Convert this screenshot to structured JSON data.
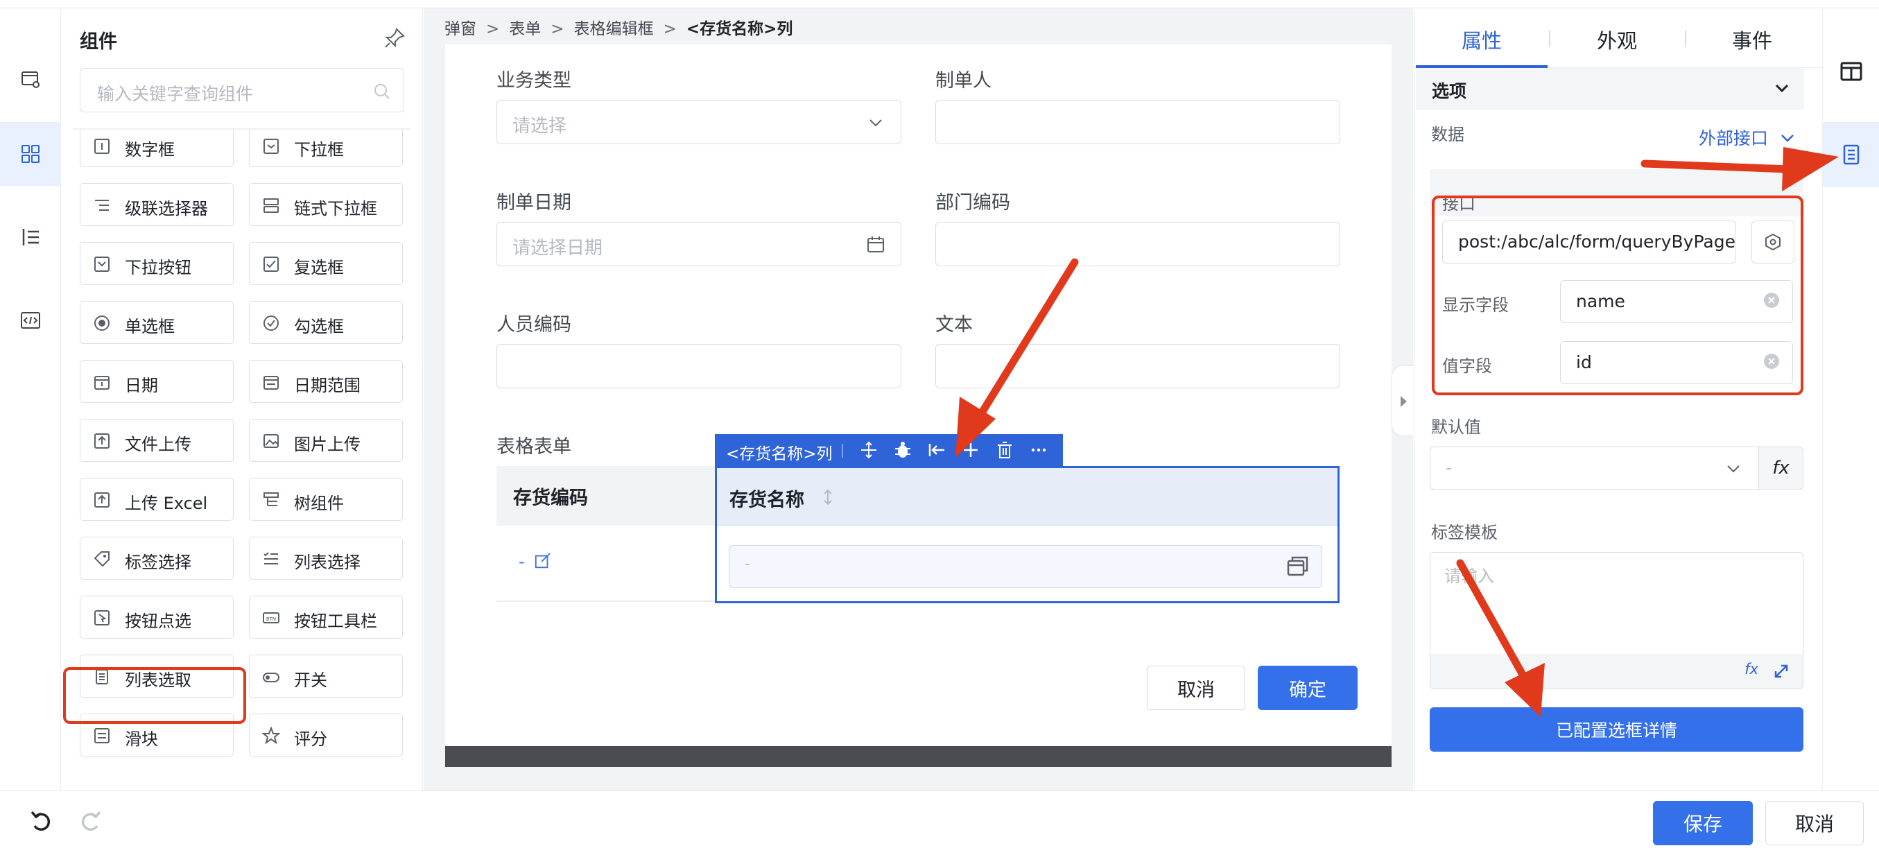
{
  "components_panel": {
    "title": "组件",
    "search_placeholder": "输入关键字查询组件",
    "items": [
      {
        "label": "数字框",
        "icon": "number-icon"
      },
      {
        "label": "下拉框",
        "icon": "dropdown-icon"
      },
      {
        "label": "级联选择器",
        "icon": "cascade-icon"
      },
      {
        "label": "链式下拉框",
        "icon": "chain-dropdown-icon"
      },
      {
        "label": "下拉按钮",
        "icon": "dropdown-button-icon"
      },
      {
        "label": "复选框",
        "icon": "checkbox-icon"
      },
      {
        "label": "单选框",
        "icon": "radio-icon"
      },
      {
        "label": "勾选框",
        "icon": "check-circle-icon"
      },
      {
        "label": "日期",
        "icon": "calendar-icon"
      },
      {
        "label": "日期范围",
        "icon": "date-range-icon"
      },
      {
        "label": "文件上传",
        "icon": "file-upload-icon"
      },
      {
        "label": "图片上传",
        "icon": "image-upload-icon"
      },
      {
        "label": "上传 Excel",
        "icon": "excel-upload-icon"
      },
      {
        "label": "树组件",
        "icon": "tree-icon"
      },
      {
        "label": "标签选择",
        "icon": "tag-icon"
      },
      {
        "label": "列表选择",
        "icon": "list-select-icon"
      },
      {
        "label": "按钮点选",
        "icon": "button-click-icon"
      },
      {
        "label": "按钮工具栏",
        "icon": "button-toolbar-icon"
      },
      {
        "label": "列表选取",
        "icon": "list-pick-icon"
      },
      {
        "label": "开关",
        "icon": "switch-icon"
      },
      {
        "label": "滑块",
        "icon": "slider-icon"
      },
      {
        "label": "评分",
        "icon": "star-icon"
      }
    ]
  },
  "breadcrumb": {
    "items": [
      "弹窗",
      "表单",
      "表格编辑框"
    ],
    "separator": ">",
    "current": "<存货名称>列"
  },
  "form": {
    "fields": {
      "business_type": {
        "label": "业务类型",
        "placeholder": "请选择"
      },
      "creator": {
        "label": "制单人"
      },
      "create_date": {
        "label": "制单日期",
        "placeholder": "请选择日期"
      },
      "dept_code": {
        "label": "部门编码"
      },
      "person_code": {
        "label": "人员编码"
      },
      "text": {
        "label": "文本"
      }
    },
    "table": {
      "label": "表格表单",
      "col1_header": "存货编码",
      "col1_cell": "-",
      "col2_header": "存货名称",
      "col2_cell": "-",
      "toolbar_title": "<存货名称>列"
    },
    "cancel_label": "取消",
    "ok_label": "确定"
  },
  "props_panel": {
    "tabs": [
      "属性",
      "外观",
      "事件"
    ],
    "active_tab": "属性",
    "section_title": "选项",
    "data_label": "数据",
    "data_source": "外部接口",
    "api_label": "接口",
    "api_value": "post:/abc/alc/form/queryByPage",
    "display_field_label": "显示字段",
    "display_field_value": "name",
    "value_field_label": "值字段",
    "value_field_value": "id",
    "default_label": "默认值",
    "default_value": "-",
    "fx_label": "fx",
    "label_template_label": "标签模板",
    "label_template_placeholder": "请输入",
    "config_button": "已配置选框详情"
  },
  "footer": {
    "save_label": "保存",
    "cancel_label": "取消"
  },
  "colors": {
    "primary": "#3370e9",
    "highlight_red": "#e0391c",
    "selected_blue": "#2f63d8"
  }
}
